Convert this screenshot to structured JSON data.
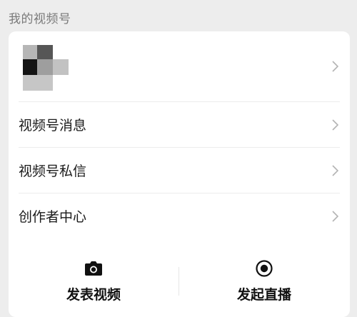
{
  "section": {
    "title": "我的视频号"
  },
  "menu": [
    {
      "label": "视频号消息"
    },
    {
      "label": "视频号私信"
    },
    {
      "label": "创作者中心"
    }
  ],
  "actions": [
    {
      "label": "发表视频",
      "icon": "camera-icon"
    },
    {
      "label": "发起直播",
      "icon": "live-record-icon"
    }
  ],
  "colors": {
    "background": "#ededed",
    "card": "#ffffff",
    "header_text": "#7a7a7a",
    "chevron": "#b3b3b3"
  }
}
